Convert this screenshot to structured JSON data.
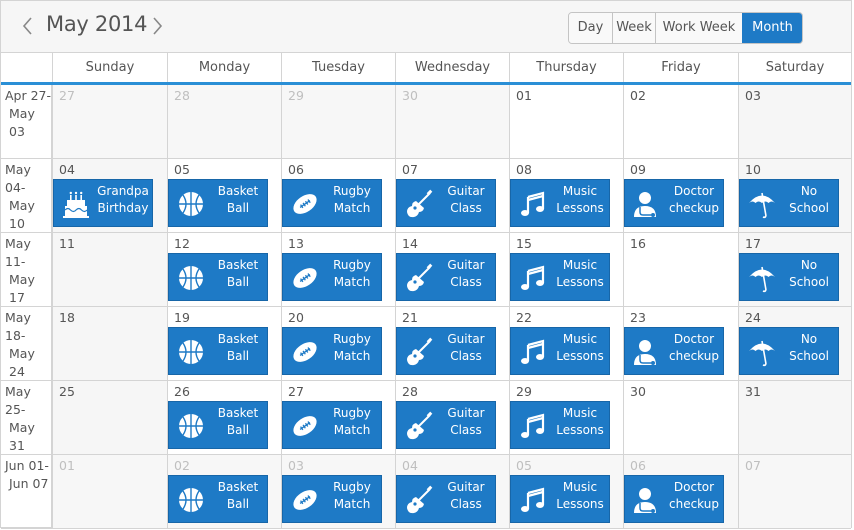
{
  "header": {
    "title": "May 2014",
    "prev_icon": "chevron-left-icon",
    "next_icon": "chevron-right-icon",
    "views": [
      {
        "label": "Day",
        "active": false
      },
      {
        "label": "Week",
        "active": false
      },
      {
        "label": "Work Week",
        "active": false
      },
      {
        "label": "Month",
        "active": true
      }
    ]
  },
  "day_names": [
    "Sunday",
    "Monday",
    "Tuesday",
    "Wednesday",
    "Thursday",
    "Friday",
    "Saturday"
  ],
  "colors": {
    "accent": "#1e7ac6",
    "header_underline": "#2a8fd6"
  },
  "weeks": [
    {
      "line1": "Apr 27-",
      "line2": "May 03",
      "days": [
        "27",
        "28",
        "29",
        "30",
        "01",
        "02",
        "03"
      ],
      "other": [
        true,
        true,
        true,
        true,
        false,
        false,
        false
      ],
      "events": [
        null,
        null,
        null,
        null,
        null,
        null,
        null
      ]
    },
    {
      "line1": "May 04-",
      "line2": "May 10",
      "days": [
        "04",
        "05",
        "06",
        "07",
        "08",
        "09",
        "10"
      ],
      "other": [
        false,
        false,
        false,
        false,
        false,
        false,
        false
      ],
      "events": [
        {
          "l1": "Grandpa",
          "l2": "Birthday",
          "icon": "cake"
        },
        {
          "l1": "Basket",
          "l2": "Ball",
          "icon": "basketball"
        },
        {
          "l1": "Rugby",
          "l2": "Match",
          "icon": "rugby"
        },
        {
          "l1": "Guitar",
          "l2": "Class",
          "icon": "guitar"
        },
        {
          "l1": "Music",
          "l2": "Lessons",
          "icon": "music"
        },
        {
          "l1": "Doctor",
          "l2": "checkup",
          "icon": "doctor"
        },
        {
          "l1": "No",
          "l2": "School",
          "icon": "umbrella"
        }
      ]
    },
    {
      "line1": "May 11-",
      "line2": "May 17",
      "days": [
        "11",
        "12",
        "13",
        "14",
        "15",
        "16",
        "17"
      ],
      "other": [
        false,
        false,
        false,
        false,
        false,
        false,
        false
      ],
      "events": [
        null,
        {
          "l1": "Basket",
          "l2": "Ball",
          "icon": "basketball"
        },
        {
          "l1": "Rugby",
          "l2": "Match",
          "icon": "rugby"
        },
        {
          "l1": "Guitar",
          "l2": "Class",
          "icon": "guitar"
        },
        {
          "l1": "Music",
          "l2": "Lessons",
          "icon": "music"
        },
        null,
        {
          "l1": "No",
          "l2": "School",
          "icon": "umbrella"
        }
      ]
    },
    {
      "line1": "May 18-",
      "line2": "May 24",
      "days": [
        "18",
        "19",
        "20",
        "21",
        "22",
        "23",
        "24"
      ],
      "other": [
        false,
        false,
        false,
        false,
        false,
        false,
        false
      ],
      "events": [
        null,
        {
          "l1": "Basket",
          "l2": "Ball",
          "icon": "basketball"
        },
        {
          "l1": "Rugby",
          "l2": "Match",
          "icon": "rugby"
        },
        {
          "l1": "Guitar",
          "l2": "Class",
          "icon": "guitar"
        },
        {
          "l1": "Music",
          "l2": "Lessons",
          "icon": "music"
        },
        {
          "l1": "Doctor",
          "l2": "checkup",
          "icon": "doctor"
        },
        {
          "l1": "No",
          "l2": "School",
          "icon": "umbrella"
        }
      ]
    },
    {
      "line1": "May 25-",
      "line2": "May 31",
      "days": [
        "25",
        "26",
        "27",
        "28",
        "29",
        "30",
        "31"
      ],
      "other": [
        false,
        false,
        false,
        false,
        false,
        false,
        false
      ],
      "events": [
        null,
        {
          "l1": "Basket",
          "l2": "Ball",
          "icon": "basketball"
        },
        {
          "l1": "Rugby",
          "l2": "Match",
          "icon": "rugby"
        },
        {
          "l1": "Guitar",
          "l2": "Class",
          "icon": "guitar"
        },
        {
          "l1": "Music",
          "l2": "Lessons",
          "icon": "music"
        },
        null,
        null
      ]
    },
    {
      "line1": "Jun 01-",
      "line2": "Jun 07",
      "days": [
        "01",
        "02",
        "03",
        "04",
        "05",
        "06",
        "07"
      ],
      "other": [
        true,
        true,
        true,
        true,
        true,
        true,
        true
      ],
      "events": [
        null,
        {
          "l1": "Basket",
          "l2": "Ball",
          "icon": "basketball"
        },
        {
          "l1": "Rugby",
          "l2": "Match",
          "icon": "rugby"
        },
        {
          "l1": "Guitar",
          "l2": "Class",
          "icon": "guitar"
        },
        {
          "l1": "Music",
          "l2": "Lessons",
          "icon": "music"
        },
        {
          "l1": "Doctor",
          "l2": "checkup",
          "icon": "doctor"
        },
        null
      ]
    }
  ]
}
